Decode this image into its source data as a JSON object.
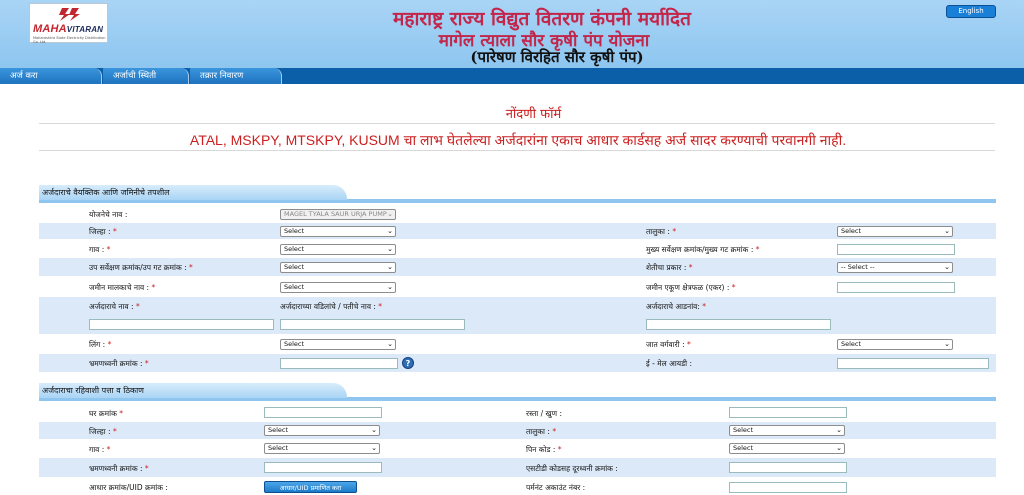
{
  "header": {
    "logo_brand_main": "MAHA",
    "logo_brand_sub": "VITARAN",
    "logo_tagline": "Maharashtra State Electricity Distribution Co. Ltd.",
    "title_line1": "महाराष्ट्र राज्य विद्युत वितरण कंपनी मर्यादित",
    "title_line2": "मागेल त्याला सौर कृषी पंप योजना",
    "title_line3": "(पारेषण विरहित सौर कृषी पंप)",
    "language_button": "English"
  },
  "nav": {
    "tabs": [
      {
        "label": "अर्ज करा"
      },
      {
        "label": "अर्जाची स्थिती"
      },
      {
        "label": "तक्रार निवारण"
      }
    ]
  },
  "form": {
    "title": "नोंदणी फॉर्म",
    "warning": "ATAL, MSKPY, MTSKPY, KUSUM चा लाभ घेतलेल्या अर्जदारांना एकाच आधार कार्डसह अर्ज सादर करण्याची परवानगी नाही."
  },
  "section1": {
    "heading": "अर्जदाराचे वैयक्तिक आणि जमिनीचे तपशील",
    "scheme_label": "योजनेचे नाव :",
    "scheme_value": "MAGEL TYALA SAUR URJA PUMP",
    "district_label": "जिल्हा :",
    "district_value": "Select",
    "taluka_label": "तालुका :",
    "taluka_value": "Select",
    "village_label": "गाव :",
    "village_value": "Select",
    "survey_label": "मुख्य सर्वेक्षण क्रमांक/मुख्य गट क्रमांक :",
    "subsurvey_label": "उप सर्वेक्षण क्रमांक/उप गट क्रमांक :",
    "subsurvey_value": "Select",
    "farming_label": "शेतीचा प्रकार :",
    "farming_value": "-- Select --",
    "owner_label": "जमीन मालकाचे नाव :",
    "owner_value": "Select",
    "area_label": "जमीन एकूण क्षेत्रफळ (एकर) :",
    "applicant_name_label": "अर्जदाराचे नाव :",
    "father_name_label": "अर्जदाराच्या वडिलांचे / पतीचे नाव :",
    "surname_label": "अर्जदाराचे आडनांव:",
    "gender_label": "लिंग :",
    "gender_value": "Select",
    "caste_label": "जात वर्गवारी :",
    "caste_value": "Select",
    "mobile_label": "भ्रमणध्वनी क्रमांक :",
    "email_label": "ई - मेल आयडी :",
    "help_icon": "?"
  },
  "section2": {
    "heading": "अर्जदाराचा रहिवाशी पत्ता व ठिकाण",
    "house_label": "घर क्रमांक",
    "road_label": "रस्ता / खुण :",
    "district_label": "जिल्हा :",
    "district_value": "Select",
    "taluka_label": "तालुका :",
    "taluka_value": "Select",
    "village_label": "गाव :",
    "village_value": "Select",
    "pincode_label": "पिन कोड :",
    "pincode_value": "Select",
    "mobile_label": "भ्रमणध्वनी क्रमांक :",
    "std_label": "एसटीडी कोडसह दूरध्वनी क्रमांक :",
    "aadhar_label": "आधार क्रमांक/UID क्रमांक :",
    "aadhar_button": "आधार/UID प्रमाणित करा",
    "permanent_label": "पर्मनंट अकाउंट नंबर :"
  },
  "required_mark": "*"
}
